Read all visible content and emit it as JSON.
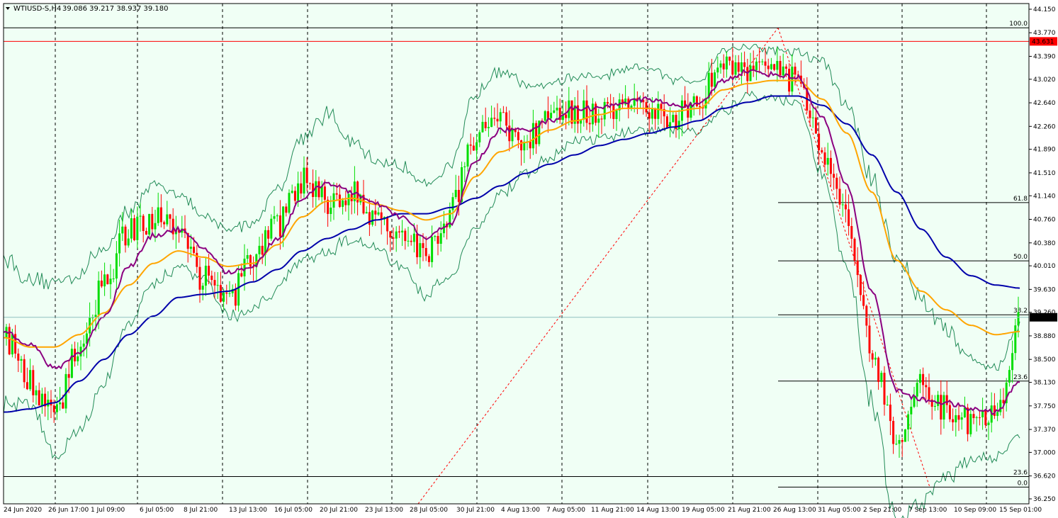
{
  "header": {
    "symbol_timeframe": "WTIUSD-S,H4",
    "ohlc_text": "39.086 39.217 38.937 39.180"
  },
  "colors": {
    "background": "#f0fff5",
    "frame": "#000000",
    "grid": "#000000",
    "bull_candle": "#00dd00",
    "bear_candle": "#ff0000",
    "ma_fast": "#8b0080",
    "ma_mid": "#ffa500",
    "ma_slow": "#0000aa",
    "bollinger": "#228b57",
    "price_line": "#8fbfbf",
    "alert_line": "#ff0000",
    "fib_line": "#000000",
    "fib_trend": "#ff0000"
  },
  "chart_data": {
    "type": "candlestick",
    "title": "WTIUSD-S,H4",
    "x_labels": [
      "24 Jun 2020",
      "26 Jun 17:00",
      "1 Jul 09:00",
      "6 Jul 05:00",
      "8 Jul 21:00",
      "13 Jul 13:00",
      "16 Jul 05:00",
      "20 Jul 21:00",
      "23 Jul 13:00",
      "28 Jul 05:00",
      "30 Jul 21:00",
      "4 Aug 13:00",
      "7 Aug 05:00",
      "11 Aug 21:00",
      "14 Aug 13:00",
      "19 Aug 05:00",
      "21 Aug 21:00",
      "26 Aug 13:00",
      "31 Aug 05:00",
      "2 Sep 21:00",
      "7 Sep 13:00",
      "10 Sep 09:00",
      "15 Sep 01:00"
    ],
    "y_ticks": [
      "44.150",
      "43.770",
      "43.390",
      "43.020",
      "42.640",
      "42.260",
      "41.890",
      "41.510",
      "41.140",
      "40.760",
      "40.380",
      "40.010",
      "39.630",
      "39.260",
      "38.880",
      "38.500",
      "38.130",
      "37.750",
      "37.370",
      "37.000",
      "36.620",
      "36.250"
    ],
    "ylim": [
      36.25,
      44.15
    ],
    "last_price": "39.180",
    "alert_price": "43.631",
    "fib_levels": [
      {
        "label": "100.0",
        "value": 43.85
      },
      {
        "label": "61.8",
        "value": 41.03
      },
      {
        "label": "50.0",
        "value": 40.09
      },
      {
        "label": "38.2",
        "value": 39.22
      },
      {
        "label": "23.6",
        "value": 38.15
      },
      {
        "label": "23.6",
        "value": 36.61
      },
      {
        "label": "0.0",
        "value": 36.44
      }
    ],
    "anchors": {
      "close": [
        38.85,
        38.15,
        37.55,
        38.7,
        39.7,
        40.6,
        40.75,
        40.6,
        39.8,
        39.4,
        40.1,
        40.65,
        41.4,
        41.05,
        41.2,
        40.8,
        40.6,
        40.2,
        40.9,
        42.1,
        42.3,
        42.0,
        42.35,
        42.5,
        42.45,
        42.7,
        42.5,
        42.4,
        42.7,
        43.3,
        43.2,
        43.1,
        43.0,
        41.8,
        40.7,
        38.6,
        37.2,
        38.1,
        37.7,
        37.5,
        37.6,
        39.18
      ],
      "ma_fast": [
        38.95,
        38.75,
        38.35,
        38.6,
        39.2,
        40.0,
        40.5,
        40.6,
        40.3,
        39.9,
        40.0,
        40.45,
        41.1,
        41.35,
        41.2,
        41.0,
        40.8,
        40.45,
        40.7,
        41.7,
        42.2,
        42.2,
        42.35,
        42.55,
        42.55,
        42.65,
        42.7,
        42.6,
        42.6,
        43.0,
        43.15,
        43.1,
        43.05,
        42.4,
        41.3,
        39.6,
        38.0,
        37.85,
        37.8,
        37.7,
        37.65,
        38.15
      ],
      "ma_mid": [
        38.85,
        38.7,
        38.7,
        38.9,
        39.25,
        39.7,
        40.05,
        40.25,
        40.15,
        40.0,
        40.05,
        40.35,
        40.8,
        41.05,
        41.1,
        41.0,
        40.9,
        40.75,
        40.85,
        41.45,
        41.85,
        42.0,
        42.2,
        42.35,
        42.45,
        42.55,
        42.55,
        42.5,
        42.55,
        42.85,
        42.95,
        43.0,
        43.0,
        42.7,
        42.15,
        41.2,
        40.1,
        39.6,
        39.3,
        39.05,
        38.9,
        38.95
      ],
      "ma_slow": [
        37.65,
        37.7,
        37.8,
        38.15,
        38.5,
        38.9,
        39.2,
        39.5,
        39.55,
        39.6,
        39.75,
        39.95,
        40.25,
        40.45,
        40.6,
        40.75,
        40.85,
        40.85,
        40.95,
        41.1,
        41.3,
        41.5,
        41.65,
        41.8,
        41.95,
        42.05,
        42.15,
        42.25,
        42.35,
        42.55,
        42.65,
        42.75,
        42.75,
        42.6,
        42.3,
        41.8,
        41.2,
        40.6,
        40.15,
        39.85,
        39.7,
        39.65
      ],
      "bb_width": [
        1.2,
        1.0,
        1.4,
        1.3,
        1.1,
        0.9,
        0.8,
        0.6,
        0.5,
        0.7,
        0.7,
        0.8,
        1.0,
        1.1,
        0.8,
        0.7,
        0.8,
        0.9,
        0.9,
        1.1,
        1.0,
        0.7,
        0.6,
        0.5,
        0.5,
        0.5,
        0.5,
        0.4,
        0.4,
        0.5,
        0.4,
        0.4,
        0.4,
        0.9,
        1.3,
        1.8,
        2.2,
        1.6,
        1.2,
        0.8,
        0.7,
        0.9
      ]
    }
  }
}
